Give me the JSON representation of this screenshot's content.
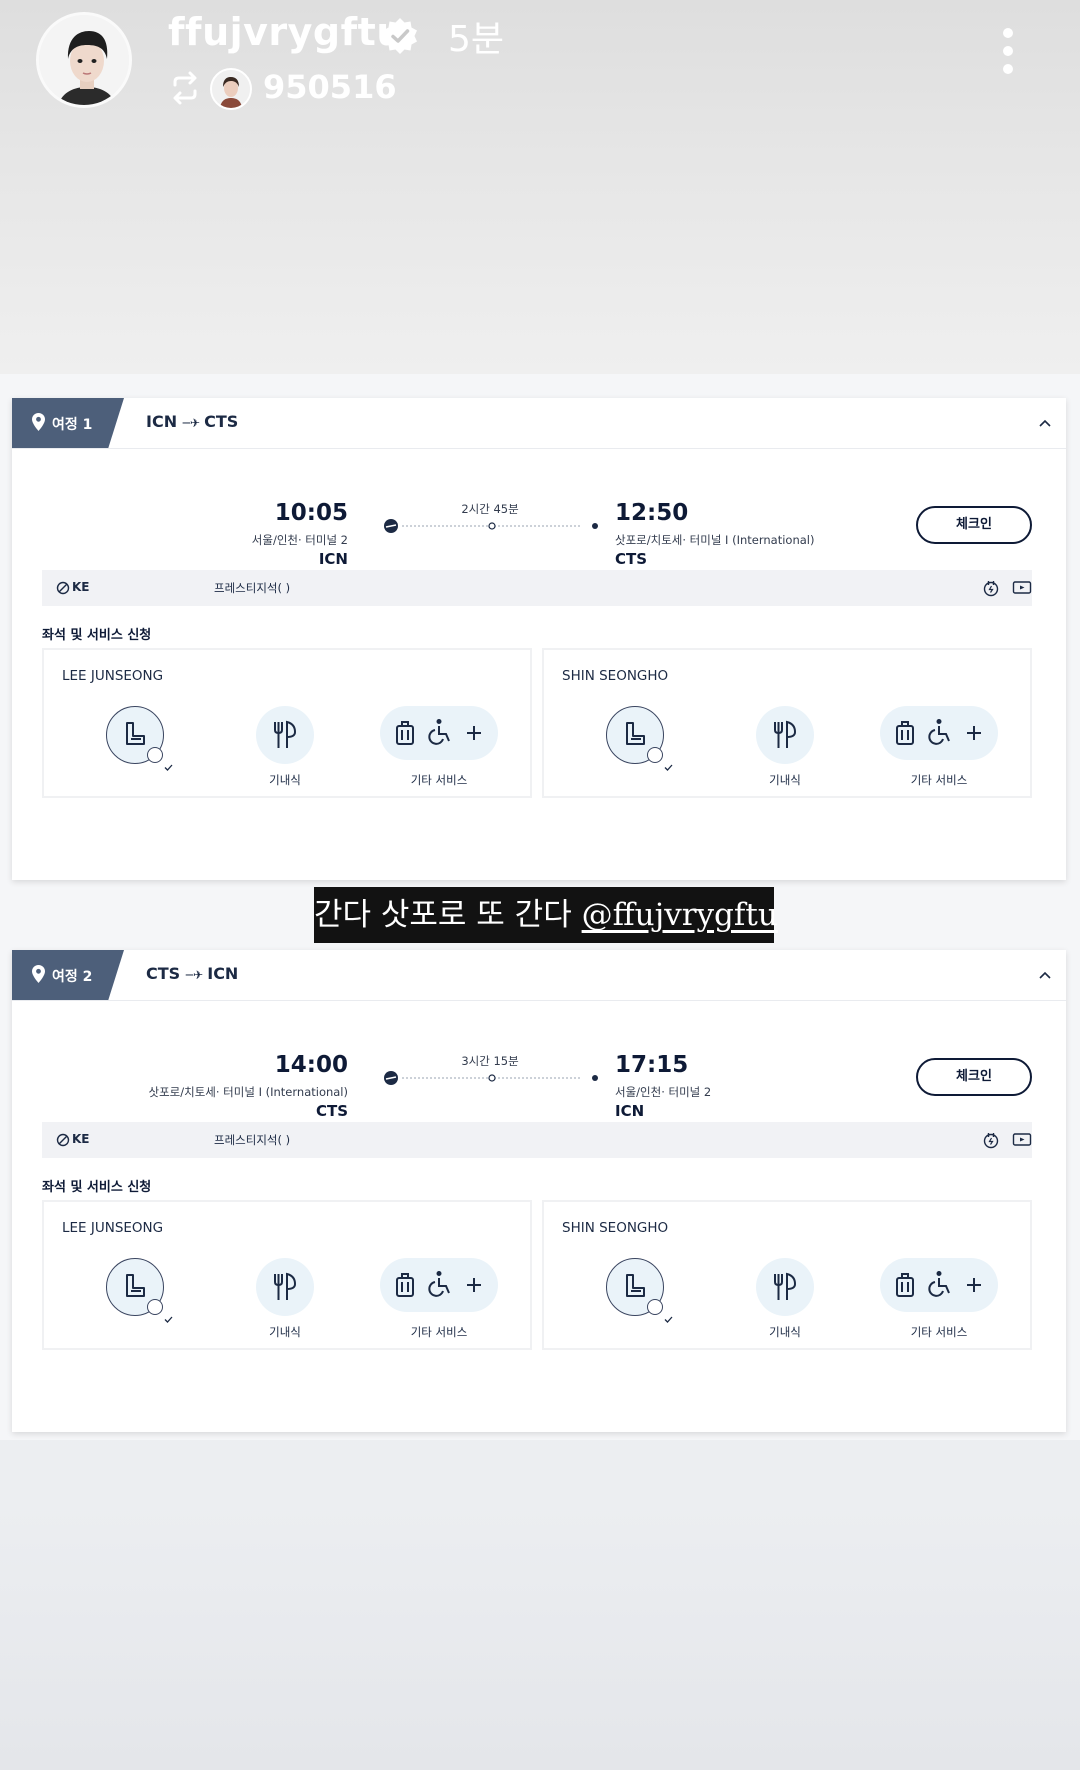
{
  "story": {
    "username": "ffujvrygftu",
    "time_ago": "5분",
    "reposted_from": "950516",
    "caption_text": "간다 삿포로 또 간다",
    "caption_mention": "@ffujvrygftu",
    "icons": [
      "verified-badge-icon",
      "repost-icon",
      "more-options-icon"
    ]
  },
  "itinerary": {
    "section_title": "좌석 및 서비스 신청",
    "checkin_label": "체크인",
    "airline": "KE",
    "seat_class": "프레스티지석( )",
    "meal_label": "기내식",
    "other_service_label": "기타 서비스",
    "legs": [
      {
        "leg_label": "여정 1",
        "route_from": "ICN",
        "route_to": "CTS",
        "departure_time": "10:05",
        "departure_terminal": "서울/인천· 터미널 2",
        "departure_code": "ICN",
        "duration": "2시간 45분",
        "arrival_time": "12:50",
        "arrival_terminal": "삿포로/치토세· 터미널 I (International)",
        "arrival_code": "CTS",
        "passengers": [
          "LEE JUNSEONG",
          "SHIN SEONGHO"
        ]
      },
      {
        "leg_label": "여정 2",
        "route_from": "CTS",
        "route_to": "ICN",
        "departure_time": "14:00",
        "departure_terminal": "삿포로/치토세· 터미널 I (International)",
        "departure_code": "CTS",
        "duration": "3시간 15분",
        "arrival_time": "17:15",
        "arrival_terminal": "서울/인천· 터미널 2",
        "arrival_code": "ICN",
        "passengers": [
          "LEE JUNSEONG",
          "SHIN SEONGHO"
        ]
      }
    ]
  },
  "colors": {
    "navy": "#0e1a36",
    "leg_tab": "#4d5f7a",
    "service_bg": "#eaf3f9",
    "caption_bg": "#121212"
  }
}
